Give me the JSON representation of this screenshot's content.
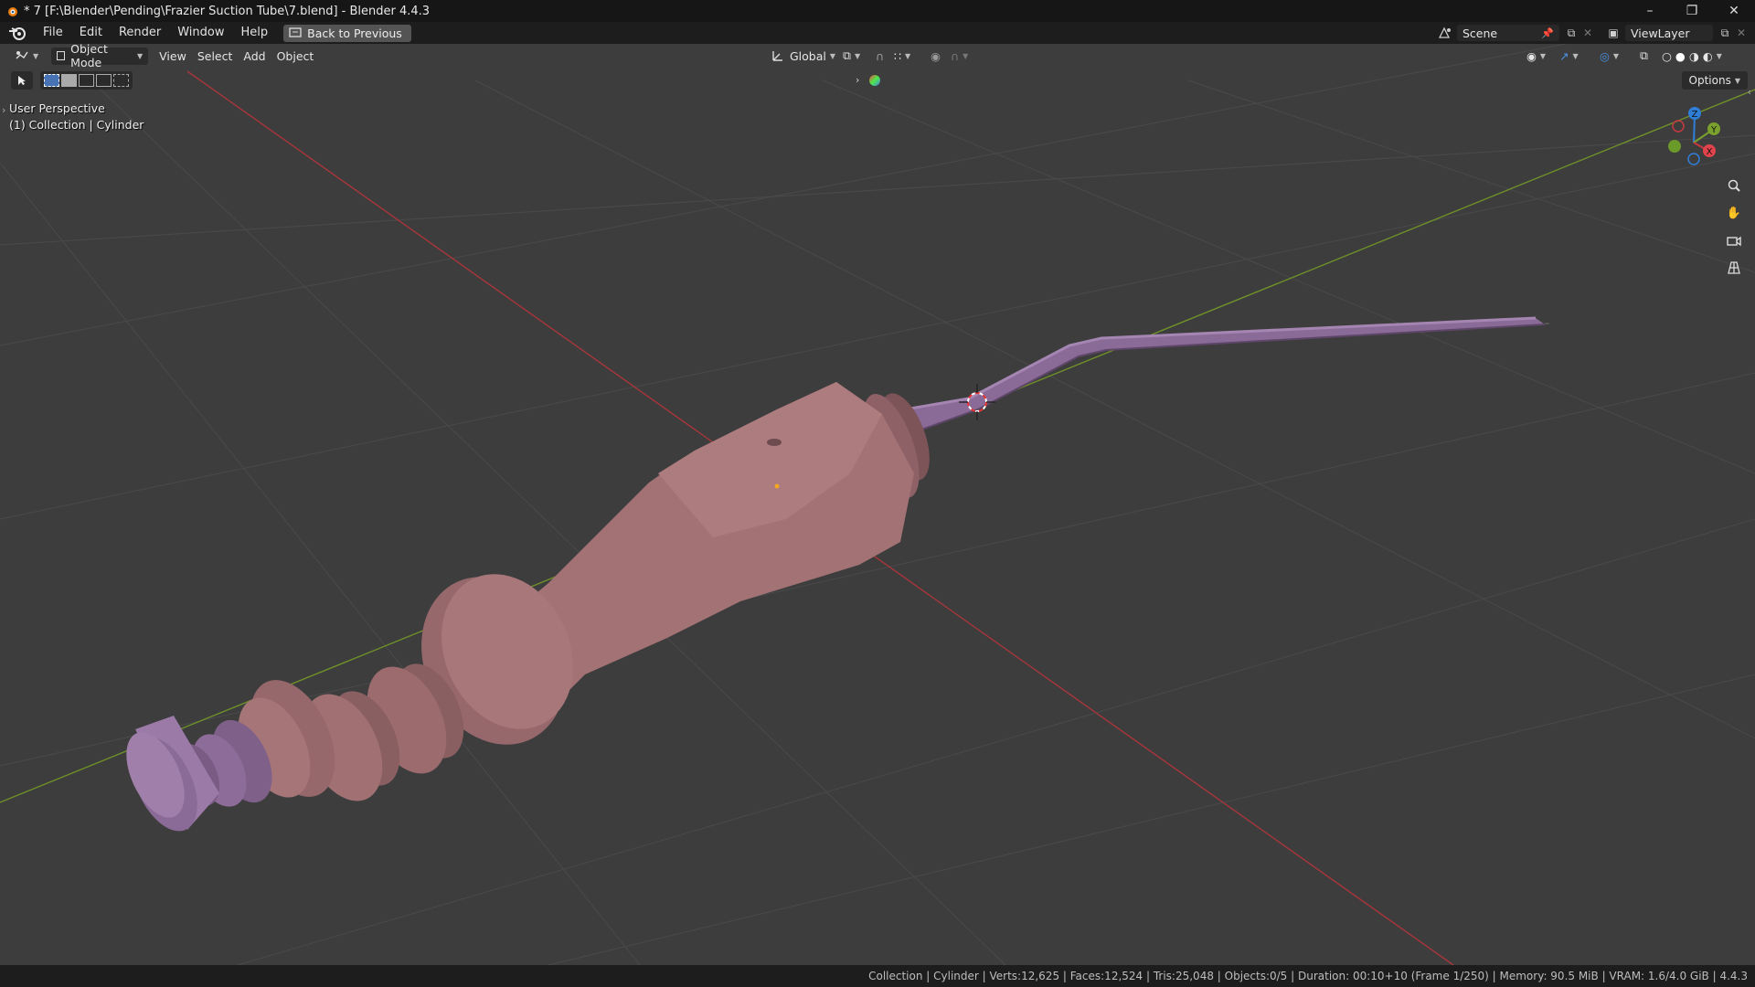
{
  "window": {
    "title": "* 7 [F:\\Blender\\Pending\\Frazier Suction Tube\\7.blend] - Blender 4.4.3",
    "minimize": "–",
    "maximize": "❐",
    "close": "✕"
  },
  "menu": {
    "items": [
      "File",
      "Edit",
      "Render",
      "Window",
      "Help"
    ],
    "back_button": "Back to Previous"
  },
  "scene": {
    "scene_name": "Scene",
    "view_layer": "ViewLayer"
  },
  "viewport_header": {
    "mode": "Object Mode",
    "menus": [
      "View",
      "Select",
      "Add",
      "Object"
    ],
    "transform_orientation": "Global",
    "options_label": "Options"
  },
  "viewport_overlay": {
    "perspective": "User Perspective",
    "collection": "(1) Collection | Cylinder"
  },
  "gizmo": {
    "x": "X",
    "y": "Y",
    "z": "Z"
  },
  "statusbar": {
    "text": "Collection | Cylinder | Verts:12,625 | Faces:12,524 | Tris:25,048 | Objects:0/5 | Duration: 00:10+10 (Frame 1/250) | Memory: 90.5 MiB | VRAM: 1.6/4.0 GiB | 4.4.3"
  },
  "colors": {
    "viewport_bg": "#3d3d3d",
    "handle_color": "#a77676",
    "tube_color": "#8e6d9a",
    "x_axis": "#c8393f",
    "y_axis": "#7aa02d",
    "z_axis": "#2f7fd8"
  }
}
